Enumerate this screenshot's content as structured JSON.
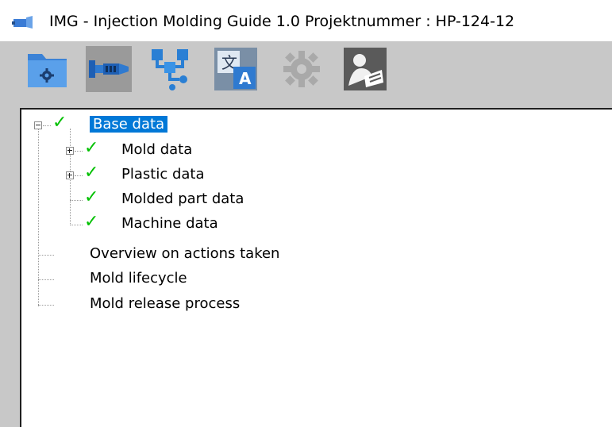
{
  "window": {
    "title": "IMG - Injection Molding Guide 1.0    Projektnummer : HP-124-12"
  },
  "toolbar": {
    "buttons": [
      {
        "name": "project-settings",
        "icon": "folder-gear-icon"
      },
      {
        "name": "injection-unit",
        "icon": "injection-unit-icon"
      },
      {
        "name": "process-flow",
        "icon": "flow-network-icon"
      },
      {
        "name": "translate",
        "icon": "translate-icon"
      },
      {
        "name": "settings",
        "icon": "gear-icon",
        "disabled": true
      },
      {
        "name": "help",
        "icon": "reader-book-icon"
      }
    ]
  },
  "tree": {
    "root": {
      "label": "Base data",
      "checked": true,
      "expanded": true,
      "selected": true
    },
    "children": [
      {
        "label": "Mold data",
        "checked": true,
        "expandable": true
      },
      {
        "label": "Plastic data",
        "checked": true,
        "expandable": true
      },
      {
        "label": "Molded part data",
        "checked": true,
        "expandable": false
      },
      {
        "label": "Machine data",
        "checked": true,
        "expandable": false
      }
    ],
    "others": [
      {
        "label": "Overview on actions taken"
      },
      {
        "label": "Mold lifecycle"
      },
      {
        "label": "Mold release process"
      }
    ],
    "check_glyph": "✓"
  },
  "colors": {
    "selection": "#0078d7",
    "check": "#00c000",
    "toolbar_bg": "#c8c8c8"
  }
}
